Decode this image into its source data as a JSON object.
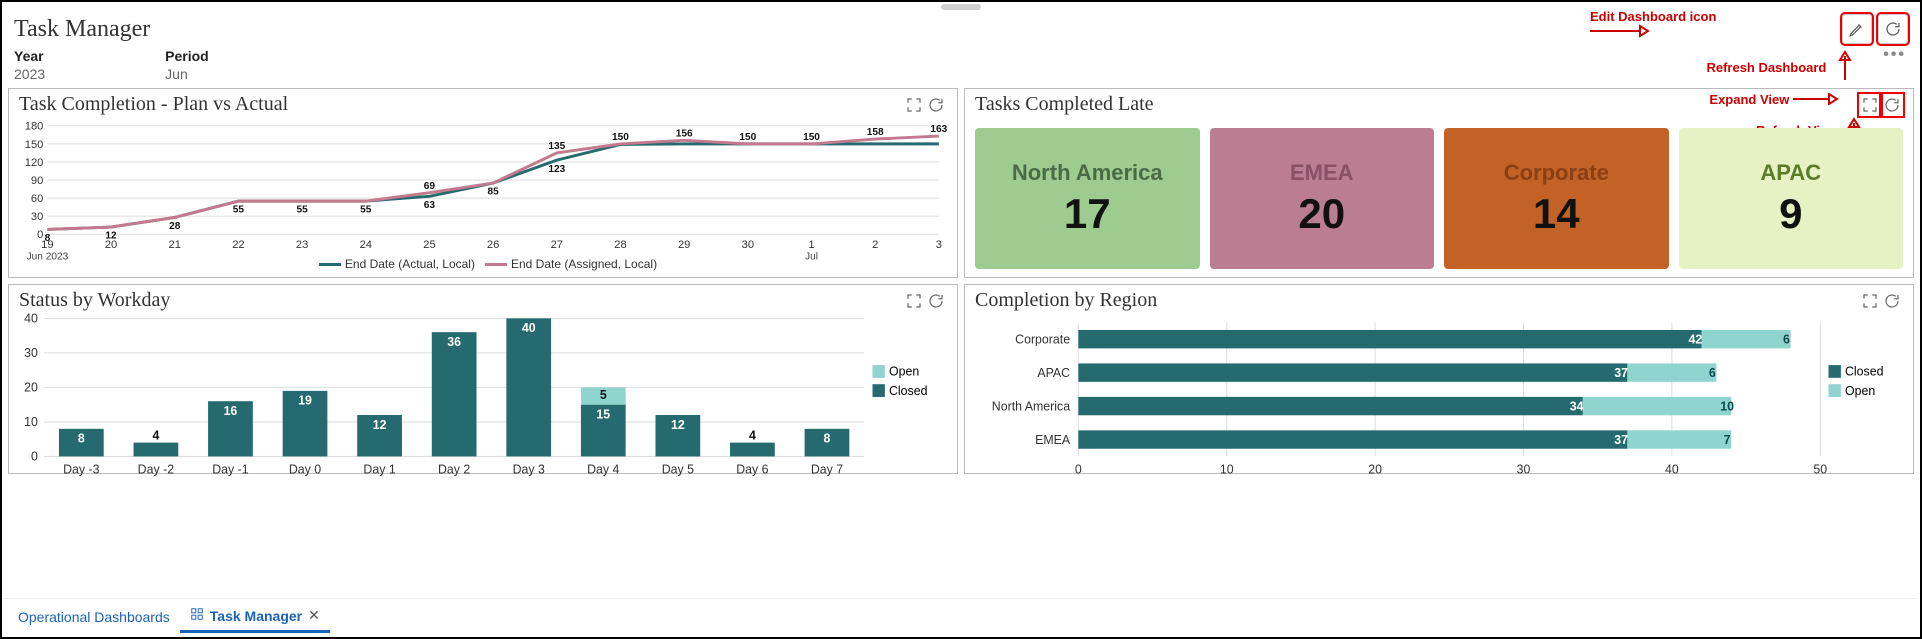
{
  "page_title": "Task Manager",
  "header_icons": {
    "edit_label": "Edit Dashboard icon",
    "refresh_label": "Refresh Dashboard",
    "expand_view_label": "Expand View",
    "refresh_view_label": "Refresh View"
  },
  "filters": {
    "year_label": "Year",
    "year_value": "2023",
    "period_label": "Period",
    "period_value": "Jun"
  },
  "tabs": {
    "link": "Operational Dashboards",
    "active": "Task Manager"
  },
  "cards": {
    "plan_vs_actual": {
      "title": "Task Completion - Plan vs Actual",
      "legend_actual": "End Date (Actual, Local)",
      "legend_assigned": "End Date (Assigned, Local)"
    },
    "tasks_late": {
      "title": "Tasks Completed Late"
    },
    "status_workday": {
      "title": "Status by Workday",
      "legend_open": "Open",
      "legend_closed": "Closed"
    },
    "completion_region": {
      "title": "Completion by Region",
      "legend_open": "Open",
      "legend_closed": "Closed"
    }
  },
  "tiles": [
    {
      "region": "North America",
      "value": 17,
      "bg": "#9ecb8f",
      "fg": "#4a6b45"
    },
    {
      "region": "EMEA",
      "value": 20,
      "bg": "#bb7d92",
      "fg": "#8a5066"
    },
    {
      "region": "Corporate",
      "value": 14,
      "bg": "#c26226",
      "fg": "#8b4014"
    },
    {
      "region": "APAC",
      "value": 9,
      "bg": "#e6f2c4",
      "fg": "#5b7a2a"
    }
  ],
  "chart_data": [
    {
      "id": "plan_vs_actual",
      "type": "line",
      "title": "Task Completion - Plan vs Actual",
      "xlabel": "",
      "ylabel": "",
      "ylim": [
        0,
        180
      ],
      "y_ticks": [
        0,
        30,
        60,
        90,
        120,
        150,
        180
      ],
      "x_categories": [
        "19",
        "20",
        "21",
        "22",
        "23",
        "24",
        "25",
        "26",
        "27",
        "28",
        "29",
        "30",
        "1",
        "2",
        "3"
      ],
      "x_sublabels": {
        "0": "Jun 2023",
        "12": "Jul"
      },
      "series": [
        {
          "name": "End Date (Actual, Local)",
          "color": "#246a6e",
          "values": [
            8,
            12,
            28,
            55,
            55,
            55,
            63,
            85,
            123,
            149,
            150,
            150,
            150,
            150,
            150
          ]
        },
        {
          "name": "End Date (Assigned, Local)",
          "color": "#c47a8e",
          "values": [
            8,
            12,
            28,
            55,
            55,
            55,
            69,
            85,
            135,
            150,
            156,
            150,
            150,
            158,
            163
          ]
        }
      ],
      "point_labels": {
        "assigned": [
          null,
          null,
          null,
          null,
          null,
          null,
          "69",
          null,
          "135",
          "150",
          "156",
          "150",
          "150",
          "158",
          "163"
        ],
        "actual": [
          "8",
          "12",
          "28",
          "55",
          "55",
          "55",
          "63",
          "85",
          "123",
          "149",
          "150",
          "150",
          "150",
          "150",
          "150"
        ]
      }
    },
    {
      "id": "status_workday",
      "type": "bar",
      "title": "Status by Workday",
      "stacked": true,
      "ylim": [
        0,
        40
      ],
      "y_ticks": [
        0,
        10,
        20,
        30,
        40
      ],
      "categories": [
        "Day -3",
        "Day -2",
        "Day -1",
        "Day 0",
        "Day 1",
        "Day 2",
        "Day 3",
        "Day 4",
        "Day 5",
        "Day 6",
        "Day 7"
      ],
      "series": [
        {
          "name": "Closed",
          "color": "#246a6e",
          "values": [
            8,
            4,
            16,
            19,
            12,
            36,
            40,
            15,
            12,
            4,
            8
          ]
        },
        {
          "name": "Open",
          "color": "#8fd4cf",
          "values": [
            0,
            0,
            0,
            0,
            0,
            0,
            0,
            5,
            0,
            0,
            0
          ]
        }
      ]
    },
    {
      "id": "completion_region",
      "type": "bar",
      "orientation": "horizontal",
      "title": "Completion by Region",
      "stacked": true,
      "xlim": [
        0,
        50
      ],
      "x_ticks": [
        0,
        10,
        20,
        30,
        40,
        50
      ],
      "categories": [
        "Corporate",
        "APAC",
        "North America",
        "EMEA"
      ],
      "series": [
        {
          "name": "Closed",
          "color": "#246a6e",
          "values": [
            42,
            37,
            34,
            37
          ]
        },
        {
          "name": "Open",
          "color": "#8fd4cf",
          "values": [
            6,
            6,
            10,
            7
          ]
        }
      ]
    }
  ]
}
